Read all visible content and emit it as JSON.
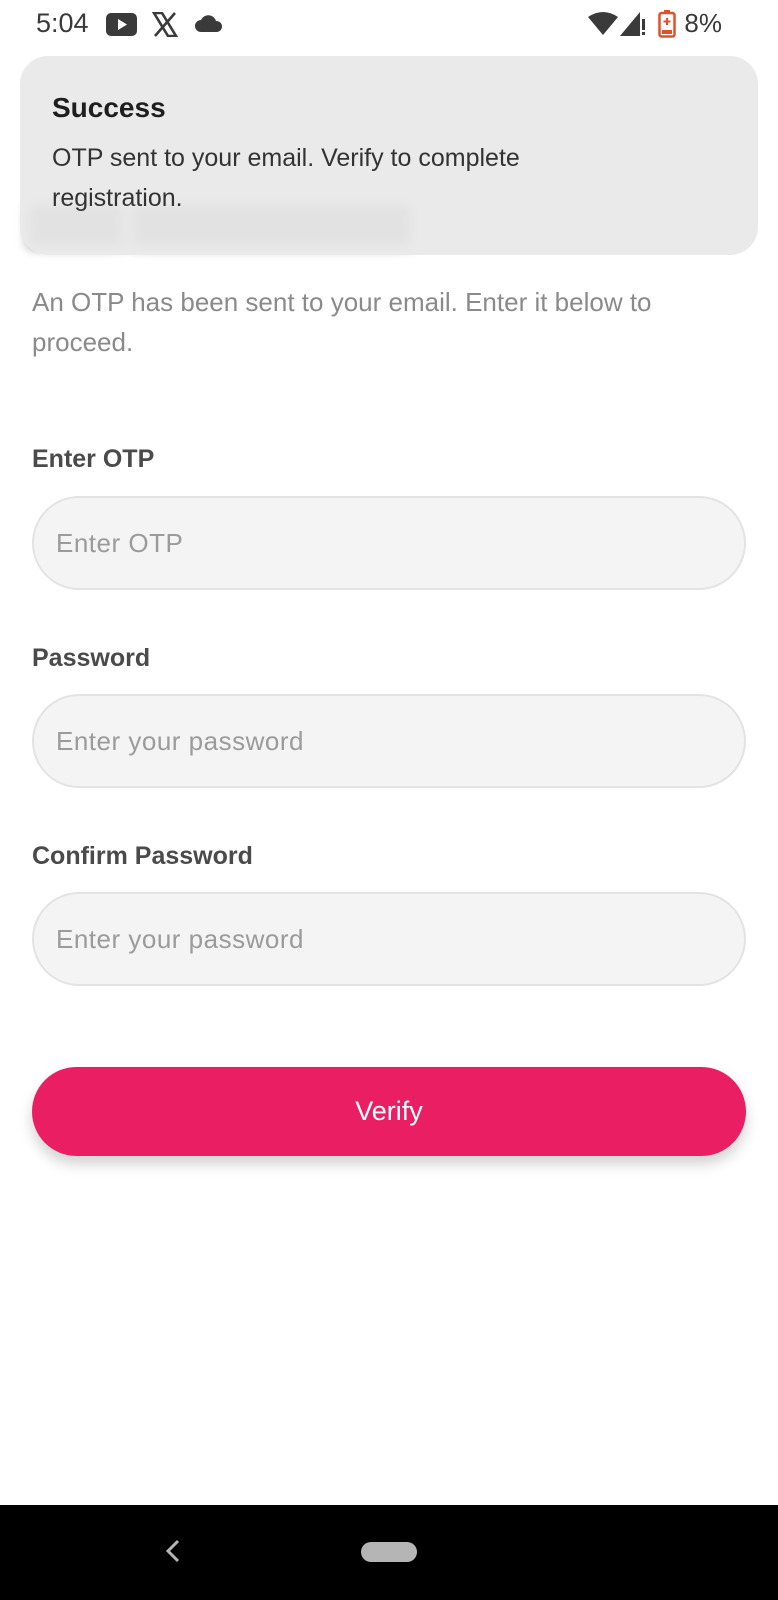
{
  "status_bar": {
    "time": "5:04",
    "battery_percent": "8%",
    "icons": [
      "youtube-icon",
      "x-icon",
      "cloud-icon",
      "wifi-icon",
      "signal-icon",
      "battery-icon"
    ]
  },
  "snackbar": {
    "title": "Success",
    "message": "OTP sent to your email. Verify to complete registration."
  },
  "page": {
    "subtitle": "An OTP has been sent to your email. Enter it below to proceed."
  },
  "form": {
    "otp_label": "Enter OTP",
    "otp_placeholder": "Enter OTP",
    "password_label": "Password",
    "password_placeholder": "Enter your password",
    "confirm_label": "Confirm Password",
    "confirm_placeholder": "Enter your password",
    "verify_label": "Verify"
  },
  "colors": {
    "accent": "#e91e63",
    "snackbar_bg": "#e9e9e9",
    "battery_low": "#e0512a"
  }
}
